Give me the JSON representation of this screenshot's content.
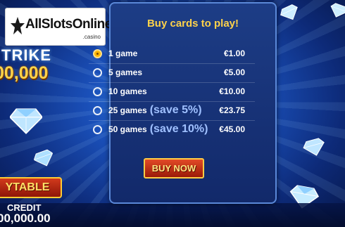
{
  "brand": {
    "logo_text": "AllSlotsOnline",
    "logo_sub": ".casino"
  },
  "game": {
    "title_fragment": "TRIKE",
    "jackpot": "00,000",
    "paytable_label": "YTABLE",
    "credit_label": "CREDIT",
    "credit_value": "00,000.00"
  },
  "dialog": {
    "title": "Buy cards to play!",
    "options": [
      {
        "label": "1 game",
        "save": "",
        "price": "€1.00",
        "selected": true
      },
      {
        "label": "5 games",
        "save": "",
        "price": "€5.00",
        "selected": false
      },
      {
        "label": "10 games",
        "save": "",
        "price": "€10.00",
        "selected": false
      },
      {
        "label": "25 games",
        "save": "(save 5%)",
        "price": "€23.75",
        "selected": false
      },
      {
        "label": "50 games",
        "save": "(save 10%)",
        "price": "€45.00",
        "selected": false
      }
    ],
    "buy_label": "BUY NOW"
  },
  "colors": {
    "accent": "#ffd24a",
    "button_red": "#c8301a",
    "panel": "#17347a"
  }
}
